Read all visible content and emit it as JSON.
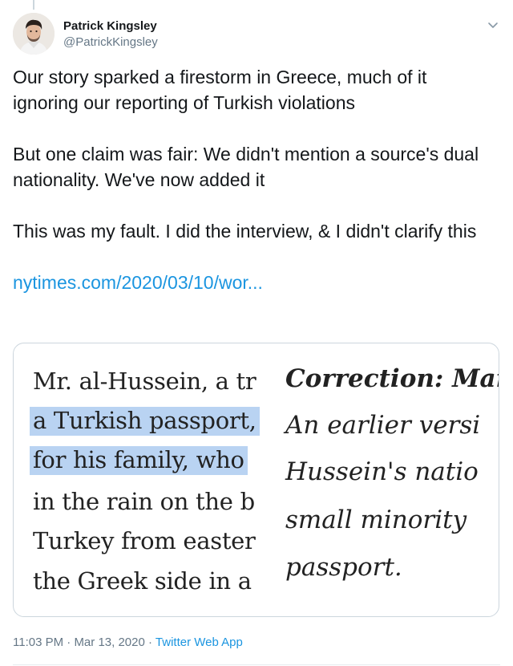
{
  "tweet": {
    "author": {
      "display_name": "Patrick Kingsley",
      "handle": "@PatrickKingsley"
    },
    "paragraphs": [
      "Our story sparked a firestorm in Greece, much of it ignoring our reporting of Turkish violations",
      "But one claim was fair: We didn't mention a source's dual nationality. We've now added it",
      "This was my fault. I did the interview, & I didn't clarify this"
    ],
    "link_text": "nytimes.com/2020/03/10/wor...",
    "media": {
      "left_lines": [
        "Mr. al-Hussein, a tr",
        "a Turkish passport,",
        "for his family, who",
        "in the rain on the b",
        "Turkey from easter",
        "the Greek side in a"
      ],
      "right_title": "Correction: Mar",
      "right_lines": [
        "An earlier versi",
        "Hussein's natio",
        "small minority",
        "passport."
      ]
    },
    "time": "11:03 PM",
    "date": "Mar 13, 2020",
    "separator": "·",
    "source_app": "Twitter Web App"
  },
  "colors": {
    "link": "#1b95e0",
    "secondary_text": "#657786",
    "highlight": "#b9d3f2",
    "border": "#ccd6dd"
  },
  "icons": {
    "caret": "chevron-down-icon"
  }
}
